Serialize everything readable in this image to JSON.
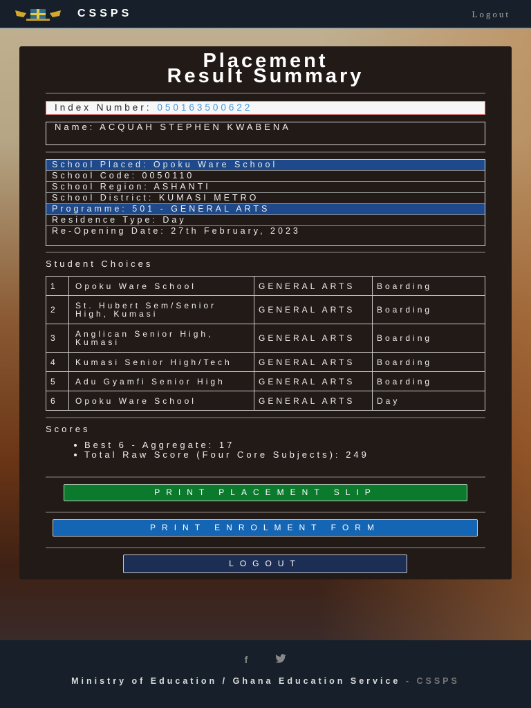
{
  "nav": {
    "brand": "CSSPS",
    "logout": "Logout"
  },
  "title": {
    "line1": "Placement",
    "line2": "Result Summary"
  },
  "index": {
    "label": "Index Number:",
    "value": "050163500622"
  },
  "name": "Name: ACQUAH STEPHEN KWABENA",
  "info": [
    "School Placed: Opoku Ware School",
    "School Code: 0050110",
    "School Region: ASHANTI",
    "School District: KUMASI METRO",
    "Programme: 501 - GENERAL ARTS",
    "Residence Type: Day",
    "Re-Opening Date: 27th February, 2023"
  ],
  "choices_heading": "Student Choices",
  "choices": [
    {
      "n": "1",
      "school": "Opoku Ware School",
      "programme": "GENERAL ARTS",
      "residence": "Boarding"
    },
    {
      "n": "2",
      "school": "St. Hubert Sem/Senior High, Kumasi",
      "programme": "GENERAL ARTS",
      "residence": "Boarding"
    },
    {
      "n": "3",
      "school": "Anglican Senior High, Kumasi",
      "programme": "GENERAL ARTS",
      "residence": "Boarding"
    },
    {
      "n": "4",
      "school": "Kumasi Senior High/Tech",
      "programme": "GENERAL ARTS",
      "residence": "Boarding"
    },
    {
      "n": "5",
      "school": "Adu Gyamfi Senior High",
      "programme": "GENERAL ARTS",
      "residence": "Boarding"
    },
    {
      "n": "6",
      "school": "Opoku Ware School",
      "programme": "GENERAL ARTS",
      "residence": "Day"
    }
  ],
  "scores_heading": "Scores",
  "scores": [
    "Best 6 - Aggregate: 17",
    "Total Raw Score (Four Core Subjects): 249"
  ],
  "buttons": {
    "slip": "PRINT PLACEMENT SLIP",
    "form": "PRINT ENROLMENT FORM",
    "logout": "LOGOUT"
  },
  "footer": {
    "text": "Ministry of Education / Ghana Education Service",
    "sep": " - ",
    "brand": "CSSPS",
    "icons": [
      "facebook-icon",
      "twitter-icon"
    ]
  }
}
